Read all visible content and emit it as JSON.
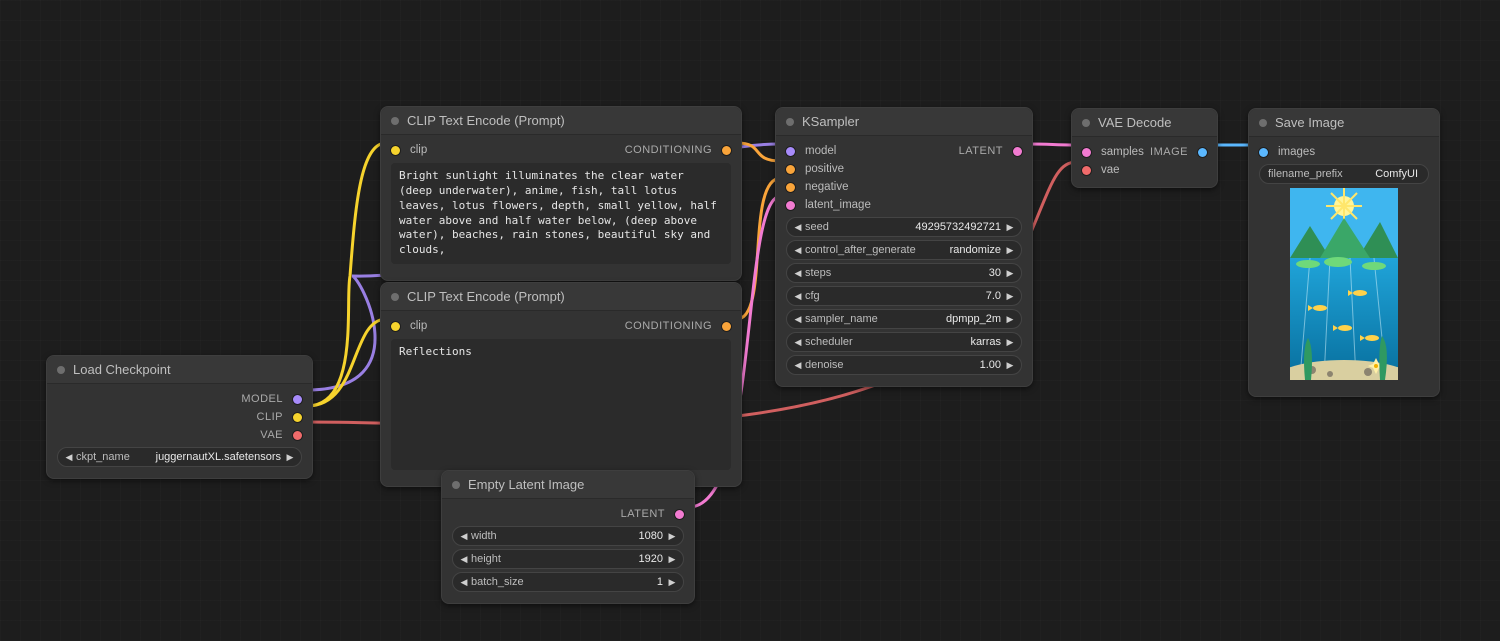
{
  "nodes": {
    "load_checkpoint": {
      "title": "Load Checkpoint",
      "outputs": {
        "model": "MODEL",
        "clip": "CLIP",
        "vae": "VAE"
      },
      "widget_ckpt": {
        "label": "ckpt_name",
        "value": "juggernautXL.safetensors"
      }
    },
    "clip_prompt_pos": {
      "title": "CLIP Text Encode (Prompt)",
      "input_clip": "clip",
      "output": "CONDITIONING",
      "text": "Bright sunlight illuminates the clear water (deep underwater), anime, fish, tall lotus leaves, lotus flowers, depth, small yellow, half water above and half water below, (deep above water), beaches, rain stones, beautiful sky and clouds,"
    },
    "clip_prompt_neg": {
      "title": "CLIP Text Encode (Prompt)",
      "input_clip": "clip",
      "output": "CONDITIONING",
      "text": "Reflections"
    },
    "empty_latent": {
      "title": "Empty Latent Image",
      "output": "LATENT",
      "width": {
        "label": "width",
        "value": "1080"
      },
      "height": {
        "label": "height",
        "value": "1920"
      },
      "batch": {
        "label": "batch_size",
        "value": "1"
      }
    },
    "ksampler": {
      "title": "KSampler",
      "inputs": {
        "model": "model",
        "positive": "positive",
        "negative": "negative",
        "latent": "latent_image"
      },
      "output": "LATENT",
      "seed": {
        "label": "seed",
        "value": "49295732492721"
      },
      "control": {
        "label": "control_after_generate",
        "value": "randomize"
      },
      "steps": {
        "label": "steps",
        "value": "30"
      },
      "cfg": {
        "label": "cfg",
        "value": "7.0"
      },
      "sampler": {
        "label": "sampler_name",
        "value": "dpmpp_2m"
      },
      "scheduler": {
        "label": "scheduler",
        "value": "karras"
      },
      "denoise": {
        "label": "denoise",
        "value": "1.00"
      }
    },
    "vae_decode": {
      "title": "VAE Decode",
      "inputs": {
        "samples": "samples",
        "vae": "vae"
      },
      "output": "IMAGE"
    },
    "save_image": {
      "title": "Save Image",
      "input": "images",
      "prefix": {
        "label": "filename_prefix",
        "value": "ComfyUI"
      }
    }
  },
  "colors": {
    "model": "#a78bfa",
    "clip": "#f6d32d",
    "vae": "#f06b6b",
    "conditioning": "#f9a43a",
    "latent": "#f27bd1",
    "image": "#5bb8ff"
  }
}
